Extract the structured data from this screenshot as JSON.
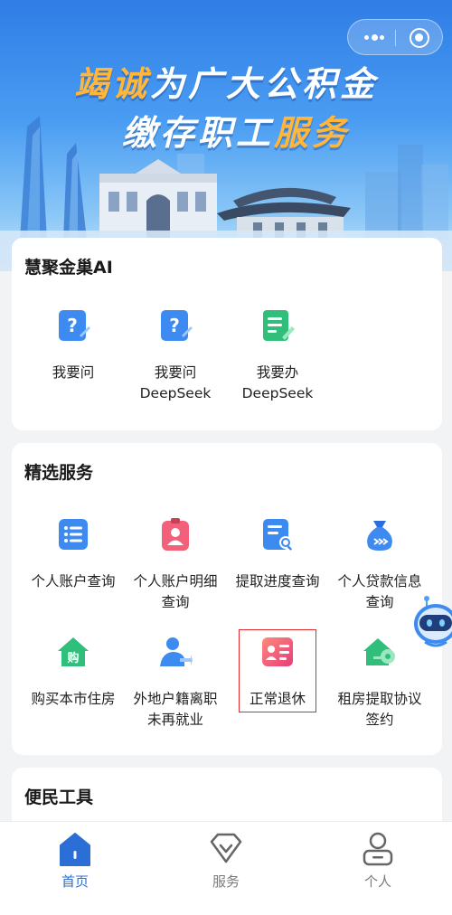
{
  "banner": {
    "slogan_line1_highlight": "竭诚",
    "slogan_line1_rest": "为广大公积金",
    "slogan_line2_rest": "缴存职工",
    "slogan_line2_highlight": "服务"
  },
  "capsule": {
    "more_icon": "more-dots-icon",
    "close_icon": "close-target-icon"
  },
  "ai_section": {
    "title": "慧聚金巢AI",
    "items": [
      {
        "label": "我要问",
        "icon": "question-icon"
      },
      {
        "label": "我要问\nDeepSeek",
        "icon": "question-icon"
      },
      {
        "label": "我要办\nDeepSeek",
        "icon": "document-edit-icon"
      }
    ]
  },
  "services": {
    "title": "精选服务",
    "items": [
      {
        "label": "个人账户查询",
        "icon": "list-icon"
      },
      {
        "label": "个人账户明细\n查询",
        "icon": "id-badge-icon"
      },
      {
        "label": "提取进度查询",
        "icon": "doc-search-icon"
      },
      {
        "label": "个人贷款信息\n查询",
        "icon": "money-bag-icon"
      },
      {
        "label": "购买本市住房",
        "icon": "house-buy-icon"
      },
      {
        "label": "外地户籍离职\n未再就业",
        "icon": "person-exit-icon"
      },
      {
        "label": "正常退休",
        "icon": "retire-card-icon",
        "highlighted": true
      },
      {
        "label": "租房提取协议\n签约",
        "icon": "house-key-icon"
      }
    ]
  },
  "tools": {
    "title": "便民工具"
  },
  "tabbar": {
    "tabs": [
      {
        "label": "首页",
        "active": true
      },
      {
        "label": "服务",
        "active": false
      },
      {
        "label": "个人",
        "active": false
      }
    ]
  },
  "colors": {
    "accent": "#2b6fd6",
    "highlight_border": "#e02b2b",
    "slogan_highlight": "#ffb63a"
  }
}
